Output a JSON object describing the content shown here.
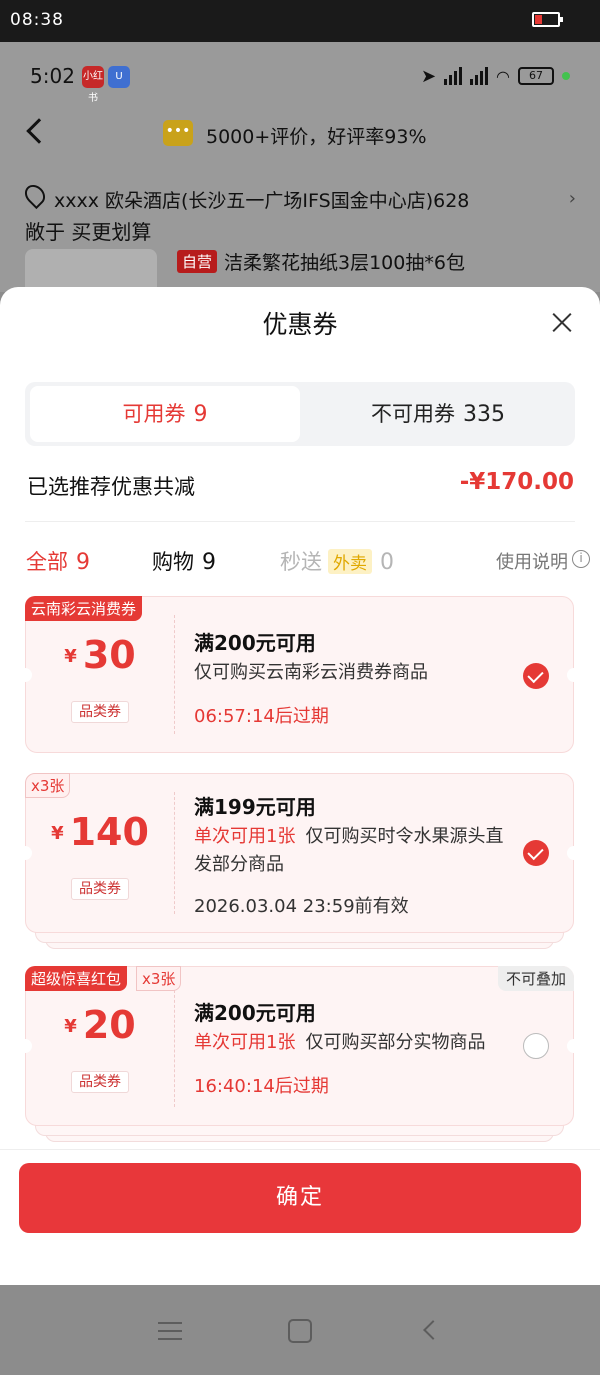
{
  "outer_status": {
    "time": "08:38"
  },
  "inner_status": {
    "time": "5:02",
    "badge1": "小红书",
    "badge2": "U",
    "battery": "67"
  },
  "header": {
    "review": "5000+评价，好评率93%"
  },
  "address": {
    "text": "xxxx 欧朵酒店(长沙五一广场IFS国金中心店)628"
  },
  "product": {
    "clipped": "敞于 买更划算",
    "self_tag": "自营",
    "name": "洁柔繁花抽纸3层100抽*6包"
  },
  "sheet": {
    "title": "优惠券",
    "tabs": [
      {
        "label": "可用券",
        "count": "9"
      },
      {
        "label": "不可用券",
        "count": "335"
      }
    ],
    "saving_label": "已选推荐优惠共减",
    "saving_amount": "-¥170.00",
    "filters": {
      "all_label": "全部",
      "all_count": "9",
      "shop_label": "购物",
      "shop_count": "9",
      "fast_label": "秒送",
      "takeout": "外卖",
      "fast_count": "0",
      "usage_note": "使用说明"
    },
    "coupons": [
      {
        "tag": "云南彩云消费券",
        "yen": "¥",
        "amount": "30",
        "category": "品类券",
        "title": "满200元可用",
        "desc": "仅可购买云南彩云消费券商品",
        "time": "06:57:14后过期",
        "selected": true
      },
      {
        "tag": "x3张",
        "yen": "¥",
        "amount": "140",
        "category": "品类券",
        "title": "满199元可用",
        "highlight": "单次可用1张",
        "desc": "仅可购买时令水果源头直发部分商品",
        "time": "2026.03.04 23:59前有效",
        "selected": true
      },
      {
        "tag": "超级惊喜红包",
        "tag2": "x3张",
        "badge": "不可叠加",
        "yen": "¥",
        "amount": "20",
        "category": "品类券",
        "title": "满200元可用",
        "highlight": "单次可用1张",
        "desc": "仅可购买部分实物商品",
        "time": "16:40:14后过期",
        "selected": false
      }
    ],
    "confirm": "确定"
  },
  "colors": {
    "accent": "#e53935",
    "coupon_bg": "#fef4f4",
    "takeout_bg": "#fdf1c4"
  }
}
